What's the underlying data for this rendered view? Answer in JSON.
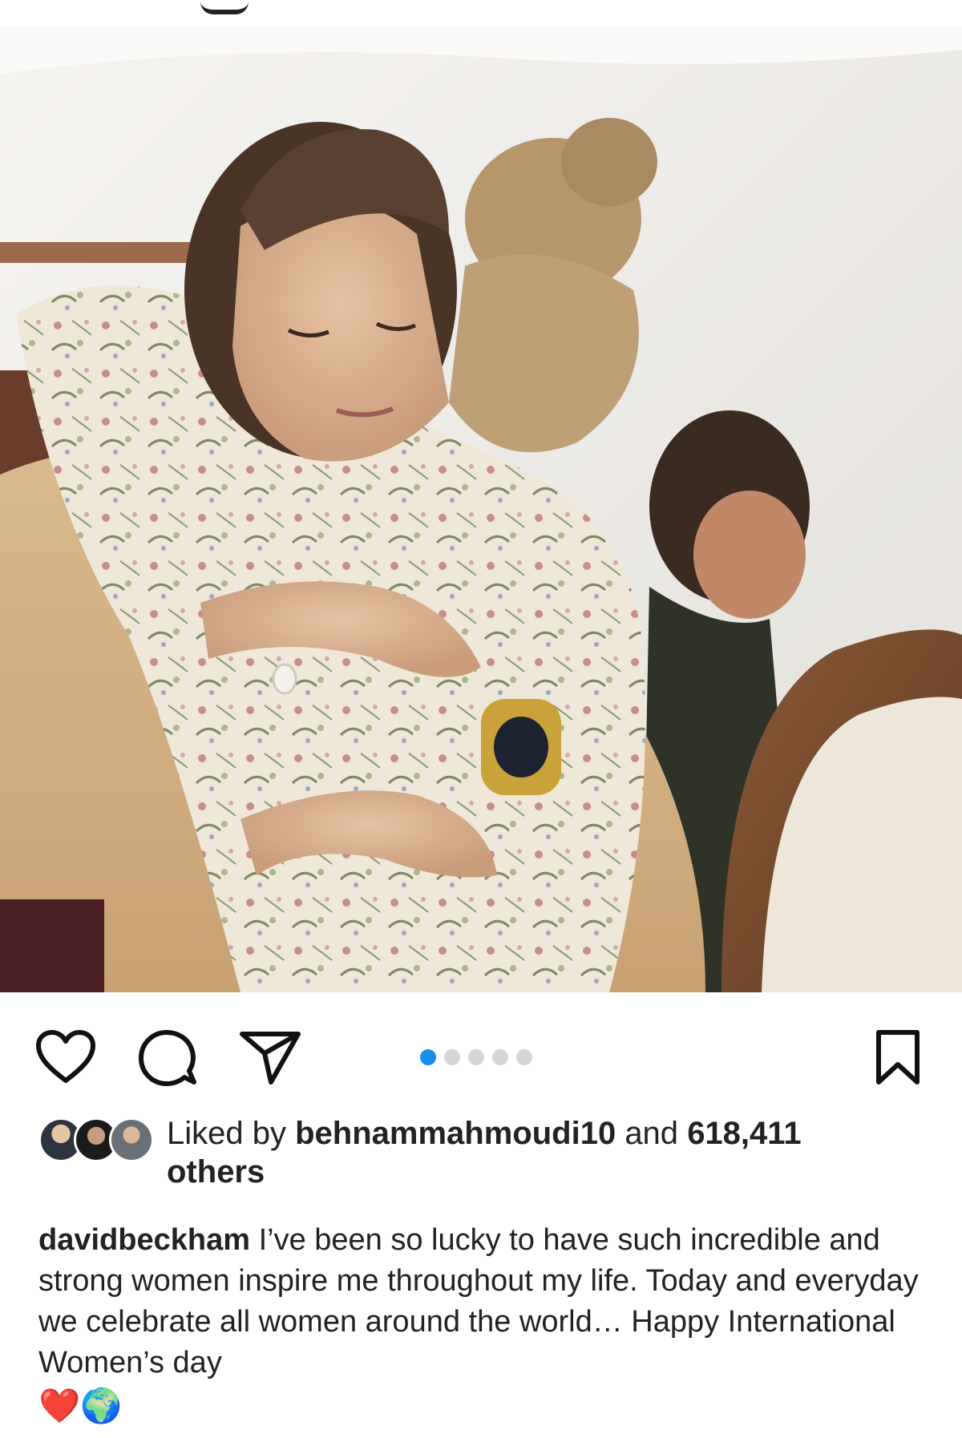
{
  "post": {
    "photo_alt": "",
    "carousel": {
      "count": 5,
      "active_index": 0
    },
    "likes": {
      "prefix": "Liked by",
      "liker": "behnammahmoudi10",
      "connector": "and",
      "count": "618,411",
      "suffix": "others"
    },
    "caption": {
      "username": "davidbeckham",
      "text": "I’ve been so lucky to have such incredible and strong women inspire me throughout my life. Today and everyday we celebrate all women around the world… Happy International Women’s day",
      "emoji": "❤️🌍"
    }
  },
  "icons": {
    "like": "heart-icon",
    "comment": "comment-icon",
    "share": "paper-plane-icon",
    "save": "bookmark-icon"
  },
  "colors": {
    "active_dot": "#1a8cf0",
    "inactive_dot": "#d6d6d6",
    "text": "#222222"
  }
}
